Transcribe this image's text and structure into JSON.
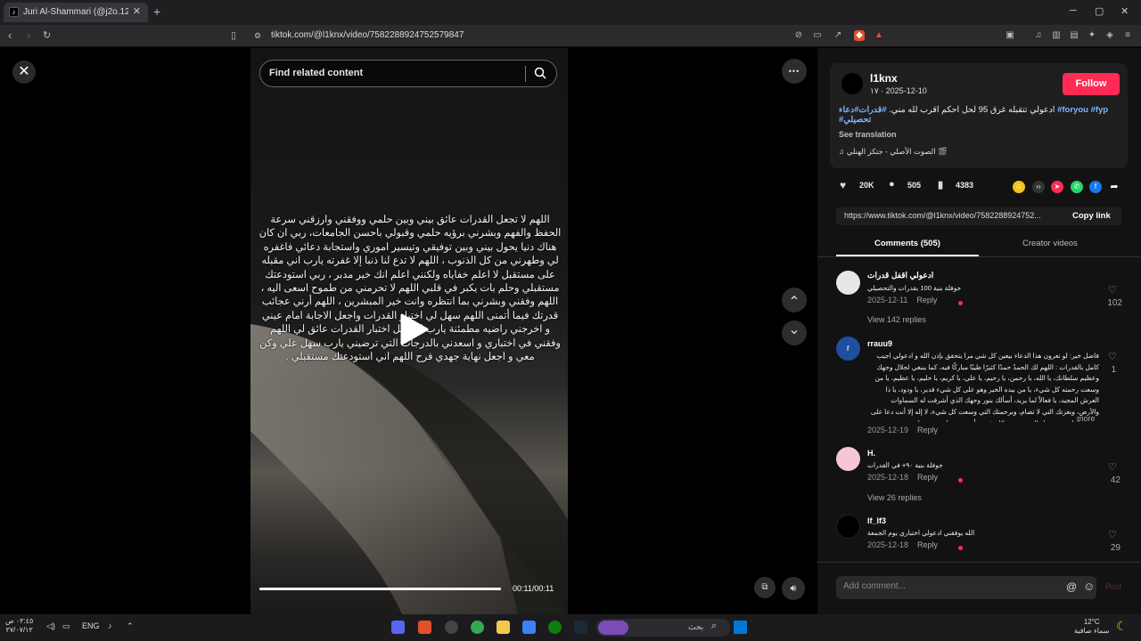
{
  "browser": {
    "tab_title": "Juri Al-Shammari (@j2o.12) | Tik",
    "tab_favicon": "tiktok-icon",
    "tab_close": "✕",
    "new_tab": "+",
    "window_minimize": "─",
    "window_maximize": "▢",
    "window_close": "✕",
    "url": "tiktok.com/@l1knx/video/7582288924752579847"
  },
  "video": {
    "close_glyph": "✕",
    "search_placeholder": "Find related content",
    "overlay_text": "اللهم لا تجعل القدرات عائق بيني وبين حلمي ووفقني وارزقني سرعة الحفظ والفهم وبشرني برؤيه حلمي وقبولي باحسن الجامعات، ربي ان كان هناك دنيا يحول بيني وبين توفيقي وتيسير اموري واستجابة دعائي فاغفره لي وطهرني من كل الذنوب ، اللهم لا تدع لنا ذنبا إلا غفرته يارب اني مقبله على مستقبل لا اعلم خفاياه ولكنني اعلم انك خير مدبر ، ربي استودعتك مستقبلي وحلم بات يكبر في قلبي اللهم لا تحرمني من طموح اسعى اليه ، اللهم وفقني وبشرني بما انتظره وانت خير المبشرين ، اللهم أرني عجائب قدرتك فيما أتمنى اللهم سهل لي اختبار القدرات واجعل الاجابة امام عيني و اخرجني راضيه مطمئنة يارب لا تجعل اختبار القدرات عائق لي اللهم وفقني في اختباري و اسعدني بالدرجات التي ترضيني يارب سهل علي وكن معي و اجعل نهاية جهدي فرح اللهم اني استودعتك مستقبلي .",
    "progress": 1.0,
    "time": "00:11/00:11",
    "more_glyph": "•••",
    "up_glyph": "⌃",
    "down_glyph": "⌄"
  },
  "author": {
    "username": "l1knx",
    "date": "١٧ · 2025-12-10",
    "follow_label": "Follow",
    "caption_text": "ادعولي تتقبله غرق 95 لحل احكم اقرب لله مني.",
    "hashtags": [
      "#قدرات",
      "#دعاء",
      "#foryou",
      "#fyp",
      "#تحصيلي"
    ],
    "see_translation": "See translation",
    "sound": "♫ الصوت الأصلي - جتكز الهنلي 🎬"
  },
  "stats": {
    "likes": "20K",
    "comments": "505",
    "saves": "4383"
  },
  "share": {
    "link": "https://www.tiktok.com/@l1knx/video/7582288924752...",
    "copy_label": "Copy link"
  },
  "tabs": {
    "comments": "Comments (505)",
    "creator": "Creator videos"
  },
  "comments": [
    {
      "name": "ادعولي اقفل قدرات",
      "text": "جوفلة بنية 100 بقدرات والتحصيلي",
      "date": "2025-12-11",
      "reply": "Reply",
      "likes": "102",
      "replies": "View 142 replies",
      "avatar_color": "#e6e6e6"
    },
    {
      "name": "rrauu9",
      "text": "فاضل خير: لو تعرون هذا الدعاء بيعين كل شي مرا يتحقق بإذن الله و ادعولي اجيب كامل بالقدرات : اللهم لك الحمدُ حمدًا كثيرًا طيبًا مباركًا فيه، كما ينبغي لجلال وجهك وعظيم سلطانك، يا الله، يا رحمن، يا رحيم، يا علي، يا كريم، يا حليم، يا عظيم، يا من وسعت رحمته كل شيء، يا من بيده الخير وهو على كل شيء قدير، يا ودود، يا ذا العرش المجيد، يا فعالاً لما يريد، أسألك بنور وجهك الذي أشرقت له السماوات والأرض، وبعزتك التي لا تضام، وبرحمتك التي وسعت كل شيء، لا إله إلا أنت دعا على جميع خلقك، ويرحمتك التي وسعت كل شيء، أن تمتن علي وترحمنا ...",
      "more": "more",
      "date": "2025-12-19",
      "reply": "Reply",
      "likes": "1",
      "avatar_letter": "r",
      "avatar_color": "#1e4fa0"
    },
    {
      "name": "H.",
      "text": "جوفلة بنية ٩٠+ في القدرات",
      "date": "2025-12-18",
      "reply": "Reply",
      "likes": "42",
      "replies": "View 26 replies",
      "avatar_color": "#f5c6d3"
    },
    {
      "name": "lf_lf3",
      "text": "الله يوفقني ادعولي اختباري يوم الجمعة",
      "date": "2025-12-18",
      "reply": "Reply",
      "likes": "29",
      "avatar_color": "#000000"
    }
  ],
  "comment_box": {
    "placeholder": "Add comment...",
    "mention": "@",
    "emoji": "☺",
    "post": "Post"
  },
  "taskbar": {
    "time": "٠٢:٤٥ ص",
    "date": "٢٧/٠٧/١٢",
    "lang": "ENG",
    "search_placeholder": "بحث",
    "weather_temp": "12°C",
    "weather_desc": "سماء صافية"
  },
  "colors": {
    "follow": "#fe2c55",
    "hashtag": "#7fb4ff",
    "panel": "#121212"
  }
}
